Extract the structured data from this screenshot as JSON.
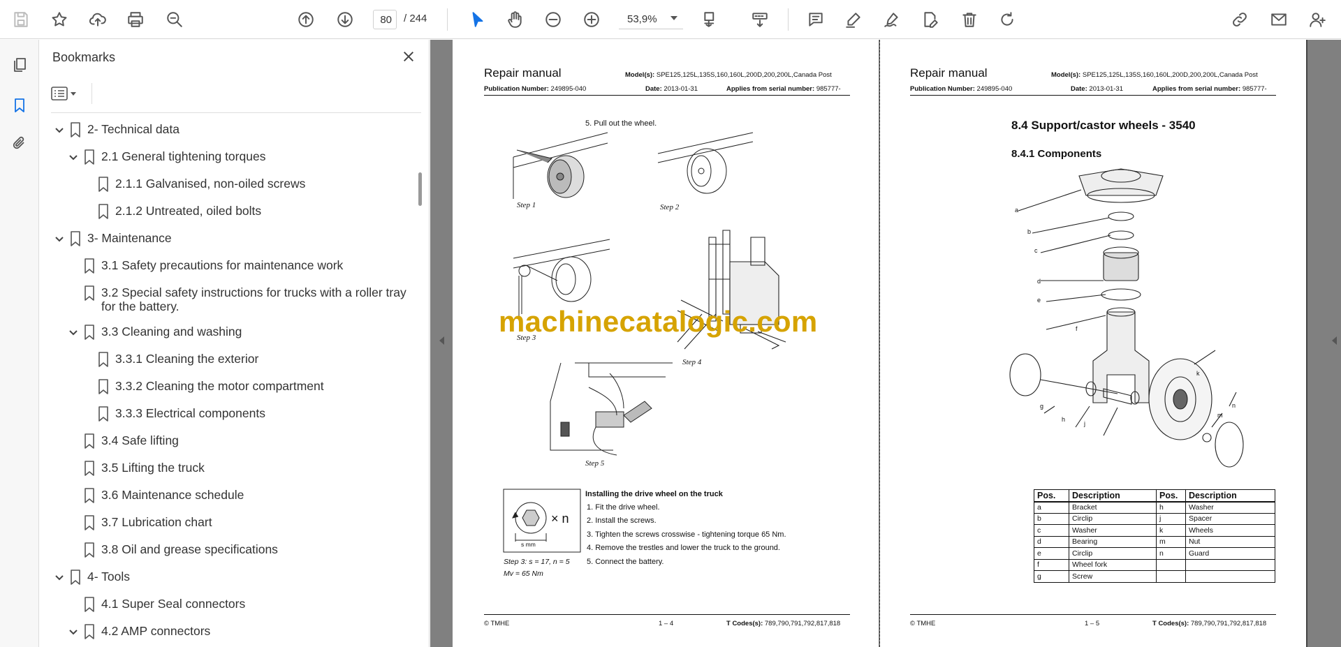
{
  "toolbar": {
    "page_current": "80",
    "page_total": "/  244",
    "zoom": "53,9%",
    "accent_color": "#1473e6",
    "icons": [
      "save-icon",
      "star-icon",
      "upload-icon",
      "print-icon",
      "zoom-search-icon",
      "page-up-icon",
      "page-down-icon",
      "select-pointer-icon",
      "hand-icon",
      "zoom-out-icon",
      "zoom-in-icon",
      "page-fit-icon",
      "scroll-mode-icon",
      "comment-icon",
      "highlight-pen-icon",
      "sign-icon",
      "edit-pdf-icon",
      "delete-icon",
      "rotate-icon",
      "share-link-icon",
      "email-icon",
      "add-user-icon"
    ]
  },
  "sidebar": {
    "title": "Bookmarks",
    "items": [
      {
        "label": "2- Technical data",
        "level": 0,
        "expandable": true
      },
      {
        "label": "2.1 General tightening torques",
        "level": 1,
        "expandable": true
      },
      {
        "label": "2.1.1 Galvanised, non-oiled screws",
        "level": 2,
        "expandable": false
      },
      {
        "label": "2.1.2 Untreated, oiled bolts",
        "level": 2,
        "expandable": false
      },
      {
        "label": "3- Maintenance",
        "level": 0,
        "expandable": true
      },
      {
        "label": "3.1 Safety precautions for maintenance work",
        "level": 1,
        "expandable": false
      },
      {
        "label": "3.2 Special safety instructions for trucks with a roller tray",
        "label2": "for the battery.",
        "level": 1,
        "expandable": false
      },
      {
        "label": "3.3 Cleaning and washing",
        "level": 1,
        "expandable": true
      },
      {
        "label": "3.3.1 Cleaning the exterior",
        "level": 2,
        "expandable": false
      },
      {
        "label": "3.3.2 Cleaning the motor compartment",
        "level": 2,
        "expandable": false
      },
      {
        "label": "3.3.3 Electrical components",
        "level": 2,
        "expandable": false
      },
      {
        "label": "3.4 Safe lifting",
        "level": 1,
        "expandable": false
      },
      {
        "label": "3.5 Lifting the truck",
        "level": 1,
        "expandable": false
      },
      {
        "label": "3.6 Maintenance schedule",
        "level": 1,
        "expandable": false
      },
      {
        "label": "3.7 Lubrication chart",
        "level": 1,
        "expandable": false
      },
      {
        "label": "3.8 Oil and grease specifications",
        "level": 1,
        "expandable": false
      },
      {
        "label": "4- Tools",
        "level": 0,
        "expandable": true
      },
      {
        "label": "4.1 Super Seal connectors",
        "level": 1,
        "expandable": false
      },
      {
        "label": "4.2 AMP connectors",
        "level": 1,
        "expandable": true
      }
    ]
  },
  "page_left": {
    "header_title": "Repair manual",
    "models_label": "Model(s):",
    "models_value": "SPE125,125L,135S,160,160L,200D,200,200L,Canada Post",
    "pubnum_label": "Publication Number:",
    "pubnum_value": "249895-040",
    "date_label": "Date:",
    "date_value": "2013-01-31",
    "serial_label": "Applies from serial number:",
    "serial_value": "985777-",
    "step5_text": "5.    Pull out the wheel.",
    "steps": [
      "Step 1",
      "Step 2",
      "Step 3",
      "Step 4",
      "Step 5"
    ],
    "torque_caption1": "Step 3: s = 17, n = 5",
    "torque_caption2": "Mv = 65 Nm",
    "torque_xn": "× n",
    "torque_smm": "s mm",
    "install_title": "Installing the drive wheel on the truck",
    "install_steps": [
      "1.    Fit the drive wheel.",
      "2.    Install the screws.",
      "3.    Tighten the screws crosswise - tightening torque 65 Nm.",
      "4.    Remove the trestles and lower the truck to the ground.",
      "5.    Connect the battery."
    ],
    "footer_left": "© TMHE",
    "footer_center": "1 – 4",
    "tcodes_label": "T Codes(s):",
    "tcodes_value": "789,790,791,792,817,818"
  },
  "page_right": {
    "header_title": "Repair manual",
    "models_label": "Model(s):",
    "models_value": "SPE125,125L,135S,160,160L,200D,200,200L,Canada Post",
    "pubnum_label": "Publication Number:",
    "pubnum_value": "249895-040",
    "date_label": "Date:",
    "date_value": "2013-01-31",
    "serial_label": "Applies from serial number:",
    "serial_value": "985777-",
    "section_title": "8.4  Support/castor wheels - 3540",
    "subsection_title": "8.4.1 Components",
    "part_letters": [
      "a",
      "b",
      "c",
      "d",
      "e",
      "f",
      "g",
      "h",
      "j",
      "k",
      "m",
      "n"
    ],
    "table_headers": [
      "Pos.",
      "Description",
      "Pos.",
      "Description"
    ],
    "table_rows": [
      [
        "a",
        "Bracket",
        "h",
        "Washer"
      ],
      [
        "b",
        "Circlip",
        "j",
        "Spacer"
      ],
      [
        "c",
        "Washer",
        "k",
        "Wheels"
      ],
      [
        "d",
        "Bearing",
        "m",
        "Nut"
      ],
      [
        "e",
        "Circlip",
        "n",
        "Guard"
      ],
      [
        "f",
        "Wheel fork",
        "",
        ""
      ],
      [
        "g",
        "Screw",
        "",
        ""
      ]
    ],
    "footer_left": "© TMHE",
    "footer_center": "1 – 5",
    "tcodes_label": "T Codes(s):",
    "tcodes_value": "789,790,791,792,817,818"
  },
  "watermark": "machinecatalogic.com"
}
